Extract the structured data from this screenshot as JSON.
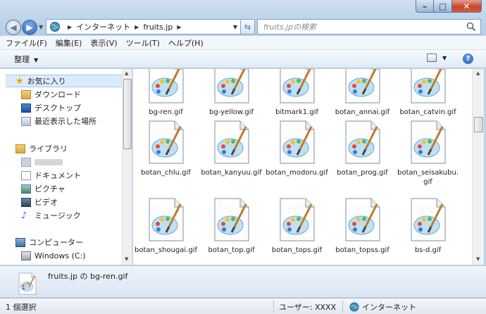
{
  "window": {
    "address_segments": [
      "インターネット",
      "fruits.jp"
    ],
    "search_placeholder": "fruits.jpの検索"
  },
  "menu": [
    "ファイル(F)",
    "編集(E)",
    "表示(V)",
    "ツール(T)",
    "ヘルプ(H)"
  ],
  "toolbar": {
    "organize_label": "整理",
    "help_label": "?"
  },
  "nav": {
    "favorites": "お気に入り",
    "fav_items": [
      "ダウンロード",
      "デスクトップ",
      "最近表示した場所"
    ],
    "libraries": "ライブラリ",
    "lib_items": [
      "ドキュメント",
      "ピクチャ",
      "ビデオ",
      "ミュージック"
    ],
    "computer": "コンピューター",
    "computer_items": [
      "Windows (C:)"
    ]
  },
  "files": [
    "bg-ren.gif",
    "bg-yellow.gif",
    "bitmark1.gif",
    "botan_annai.gif",
    "botan_catvin.gif",
    "botan_chlu.gif",
    "botan_kanyuu.gif",
    "botan_modoru.gif",
    "botan_prog.gif",
    "botan_seisakubu.gif",
    "botan_shougai.gif",
    "botan_top.gif",
    "botan_tops.gif",
    "botan_topss.gif",
    "bs-d.gif"
  ],
  "details": {
    "title": "fruits.jp の bg-ren.gif"
  },
  "status": {
    "selection": "1 個選択",
    "user": "ユーザー: XXXX",
    "zone": "インターネット"
  },
  "colors": {
    "accent": "#3b6fb6",
    "selection": "#dcebfc"
  }
}
